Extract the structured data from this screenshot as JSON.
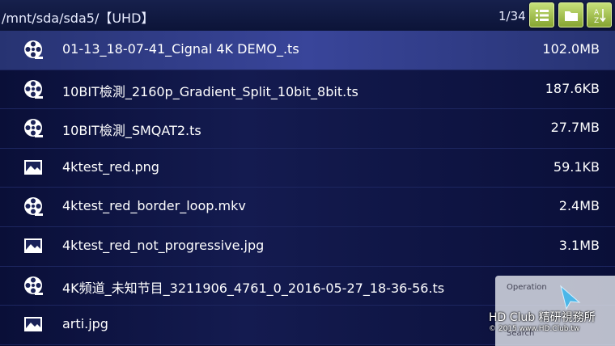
{
  "header": {
    "path": "/mnt/sda/sda5/【UHD】",
    "page_indicator": "1/34",
    "buttons": [
      "list-view-icon",
      "folder-icon",
      "sort-az-icon"
    ],
    "button_color": "#a9c752"
  },
  "files": [
    {
      "name": "01-13_18-07-41_Cignal 4K DEMO_.ts",
      "size": "102.0MB",
      "type": "video"
    },
    {
      "name": "10BIT檢測_2160p_Gradient_Split_10bit_8bit.ts",
      "size": "187.6KB",
      "type": "video"
    },
    {
      "name": "10BIT檢測_SMQAT2.ts",
      "size": "27.7MB",
      "type": "video"
    },
    {
      "name": "4ktest_red.png",
      "size": "59.1KB",
      "type": "image"
    },
    {
      "name": "4ktest_red_border_loop.mkv",
      "size": "2.4MB",
      "type": "video"
    },
    {
      "name": "4ktest_red_not_progressive.jpg",
      "size": "3.1MB",
      "type": "image"
    },
    {
      "name": "4K頻道_未知节目_3211906_4761_0_2016-05-27_18-36-56.ts",
      "size": "",
      "type": "video"
    },
    {
      "name": "arti.jpg",
      "size": "",
      "type": "image"
    }
  ],
  "menu": {
    "items": [
      "Operation",
      "",
      "Search"
    ]
  },
  "watermark": {
    "line1": "HD Club 精研視務所",
    "line2": "© 2015  www.HD.Club.tw"
  }
}
